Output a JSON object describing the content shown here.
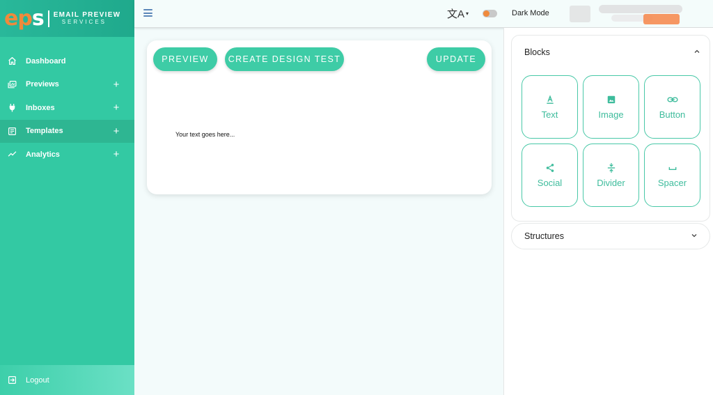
{
  "brand": {
    "logo_text": "eps",
    "line1": "EMAIL PREVIEW",
    "line2": "SERVICES"
  },
  "sidebar": {
    "items": [
      {
        "label": "Dashboard",
        "icon": "home-icon",
        "expandable": false
      },
      {
        "label": "Previews",
        "icon": "previews-icon",
        "expandable": true
      },
      {
        "label": "Inboxes",
        "icon": "plug-icon",
        "expandable": true
      },
      {
        "label": "Templates",
        "icon": "templates-icon",
        "expandable": true,
        "active": true
      },
      {
        "label": "Analytics",
        "icon": "analytics-icon",
        "expandable": true
      }
    ],
    "plus_symbol": "+",
    "logout_label": "Logout"
  },
  "topbar": {
    "translate_glyph": "文A",
    "dark_mode_label": "Dark Mode",
    "dark_mode_on": false
  },
  "editor": {
    "preview_label": "PREVIEW",
    "create_design_test_label": "CREATE DESIGN TEST",
    "update_label": "UPDATE",
    "placeholder_text": "Your text goes here..."
  },
  "panel": {
    "blocks_title": "Blocks",
    "blocks": [
      {
        "label": "Text",
        "icon": "text-icon"
      },
      {
        "label": "Image",
        "icon": "image-icon"
      },
      {
        "label": "Button",
        "icon": "link-icon"
      },
      {
        "label": "Social",
        "icon": "share-icon"
      },
      {
        "label": "Divider",
        "icon": "divider-icon"
      },
      {
        "label": "Spacer",
        "icon": "spacer-icon"
      }
    ],
    "structures_title": "Structures"
  },
  "colors": {
    "sidebar": "#33c9a3",
    "accent": "#3ecca6",
    "brand_orange": "#f08a3c"
  }
}
